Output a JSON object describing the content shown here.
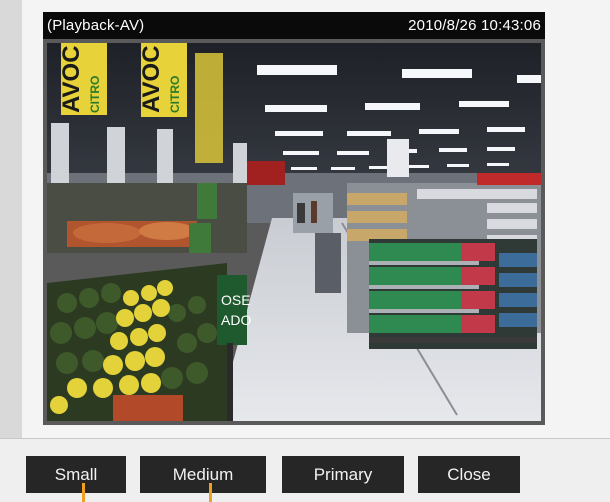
{
  "viewer": {
    "mode_label": "(Playback-AV)",
    "timestamp": "2010/8/26 10:43:06"
  },
  "scene": {
    "banner_text_1": "AVOC",
    "banner_text_2": "CITRO",
    "sign_text_1": "OSE",
    "sign_text_2": "ADO"
  },
  "buttons": {
    "small": "Small",
    "medium": "Medium",
    "primary": "Primary",
    "close": "Close"
  },
  "colors": {
    "marker": "#f0a020",
    "button_bg": "#262626"
  }
}
